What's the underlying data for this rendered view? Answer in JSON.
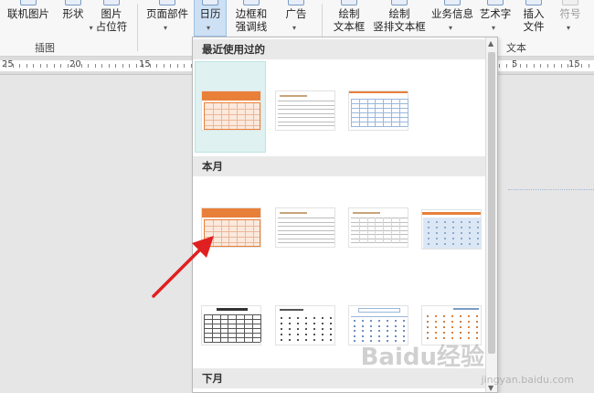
{
  "ribbon": {
    "buttons": [
      {
        "key": "online_pictures",
        "label": "联机图片"
      },
      {
        "key": "shapes",
        "label": "形状"
      },
      {
        "key": "picture_placeholder",
        "label": "图片\n占位符"
      },
      {
        "key": "page_parts",
        "label": "页面部件"
      },
      {
        "key": "calendar",
        "label": "日历"
      },
      {
        "key": "borders",
        "label": "边框和\n强调线"
      },
      {
        "key": "ads",
        "label": "广告"
      },
      {
        "key": "draw_textbox",
        "label": "绘制\n文本框"
      },
      {
        "key": "draw_vertical_textbox",
        "label": "绘制\n竖排文本框"
      },
      {
        "key": "business_info",
        "label": "业务信息"
      },
      {
        "key": "wordart",
        "label": "艺术字"
      },
      {
        "key": "insert_file",
        "label": "插入\n文件"
      },
      {
        "key": "symbol",
        "label": "符号"
      }
    ],
    "groups": {
      "illustrations": "插图",
      "text": "文本"
    }
  },
  "ruler": {
    "numbers": [
      "25",
      "20",
      "15",
      "10",
      "5",
      "15"
    ]
  },
  "gallery": {
    "sections": {
      "recent": "最近使用过的",
      "this_month": "本月",
      "next_month": "下月"
    },
    "thumb_titles": {
      "calendar_title": "JANUARY 2015"
    }
  },
  "watermark": {
    "brand": "Baidu经验",
    "url": "jingyan.baidu.com"
  },
  "colors": {
    "orange": "#e8803a",
    "blue_grid": "#9ab7db",
    "selection": "#dff1f1",
    "arrow": "#e02020"
  }
}
